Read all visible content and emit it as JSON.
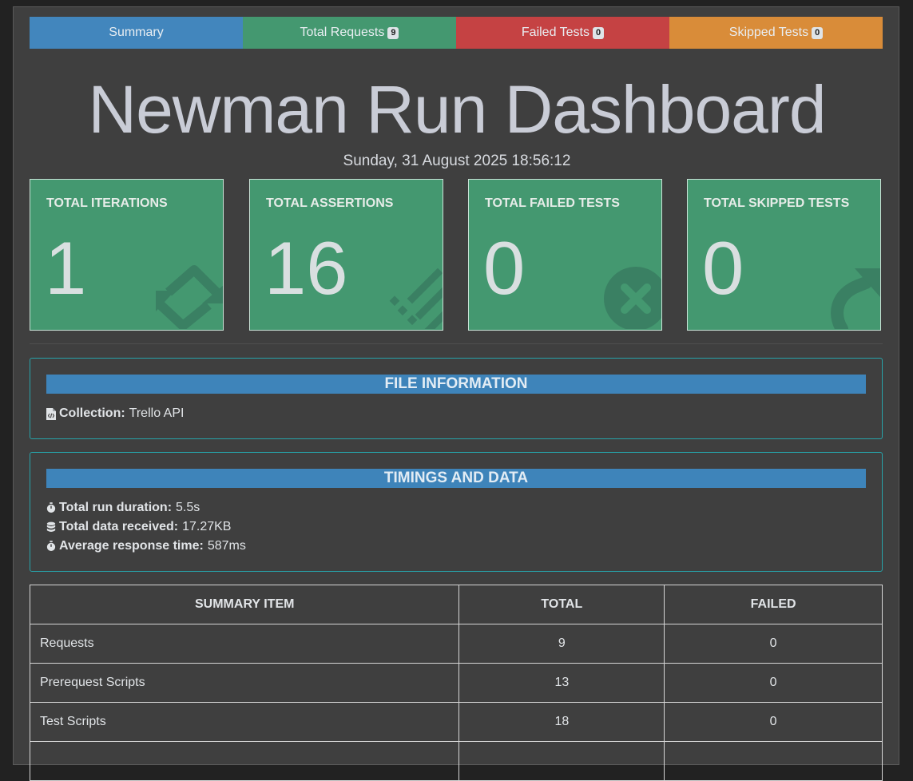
{
  "nav": {
    "tabs": [
      {
        "label": "Summary",
        "badge": "",
        "color": "#4286bd"
      },
      {
        "label": "Total Requests",
        "badge": "9",
        "color": "#449870"
      },
      {
        "label": "Failed Tests",
        "badge": "0",
        "color": "#c54243"
      },
      {
        "label": "Skipped Tests",
        "badge": "0",
        "color": "#d98c39"
      }
    ]
  },
  "header": {
    "title": "Newman Run Dashboard",
    "date": "Sunday, 31 August 2025 18:56:12"
  },
  "cards": [
    {
      "label": "TOTAL ITERATIONS",
      "value": "1",
      "icon": "sync-icon"
    },
    {
      "label": "TOTAL ASSERTIONS",
      "value": "16",
      "icon": "list-check-icon"
    },
    {
      "label": "TOTAL FAILED TESTS",
      "value": "0",
      "icon": "times-circle-icon"
    },
    {
      "label": "TOTAL SKIPPED TESTS",
      "value": "0",
      "icon": "share-arrow-icon"
    }
  ],
  "file_info": {
    "heading": "FILE INFORMATION",
    "collection_label": "Collection:",
    "collection_value": "Trello API"
  },
  "timings": {
    "heading": "TIMINGS AND DATA",
    "items": [
      {
        "label": "Total run duration:",
        "value": "5.5s",
        "icon": "stopwatch-icon"
      },
      {
        "label": "Total data received:",
        "value": "17.27KB",
        "icon": "database-icon"
      },
      {
        "label": "Average response time:",
        "value": "587ms",
        "icon": "stopwatch-icon"
      }
    ]
  },
  "summary_table": {
    "headers": [
      "SUMMARY ITEM",
      "TOTAL",
      "FAILED"
    ],
    "rows": [
      [
        "Requests",
        "9",
        "0"
      ],
      [
        "Prerequest Scripts",
        "13",
        "0"
      ],
      [
        "Test Scripts",
        "18",
        "0"
      ],
      [
        "",
        "",
        ""
      ]
    ]
  },
  "colors": {
    "card_green": "#449870",
    "panel_head_blue": "#3e84ba",
    "panel_border_teal": "#27a3a9"
  }
}
